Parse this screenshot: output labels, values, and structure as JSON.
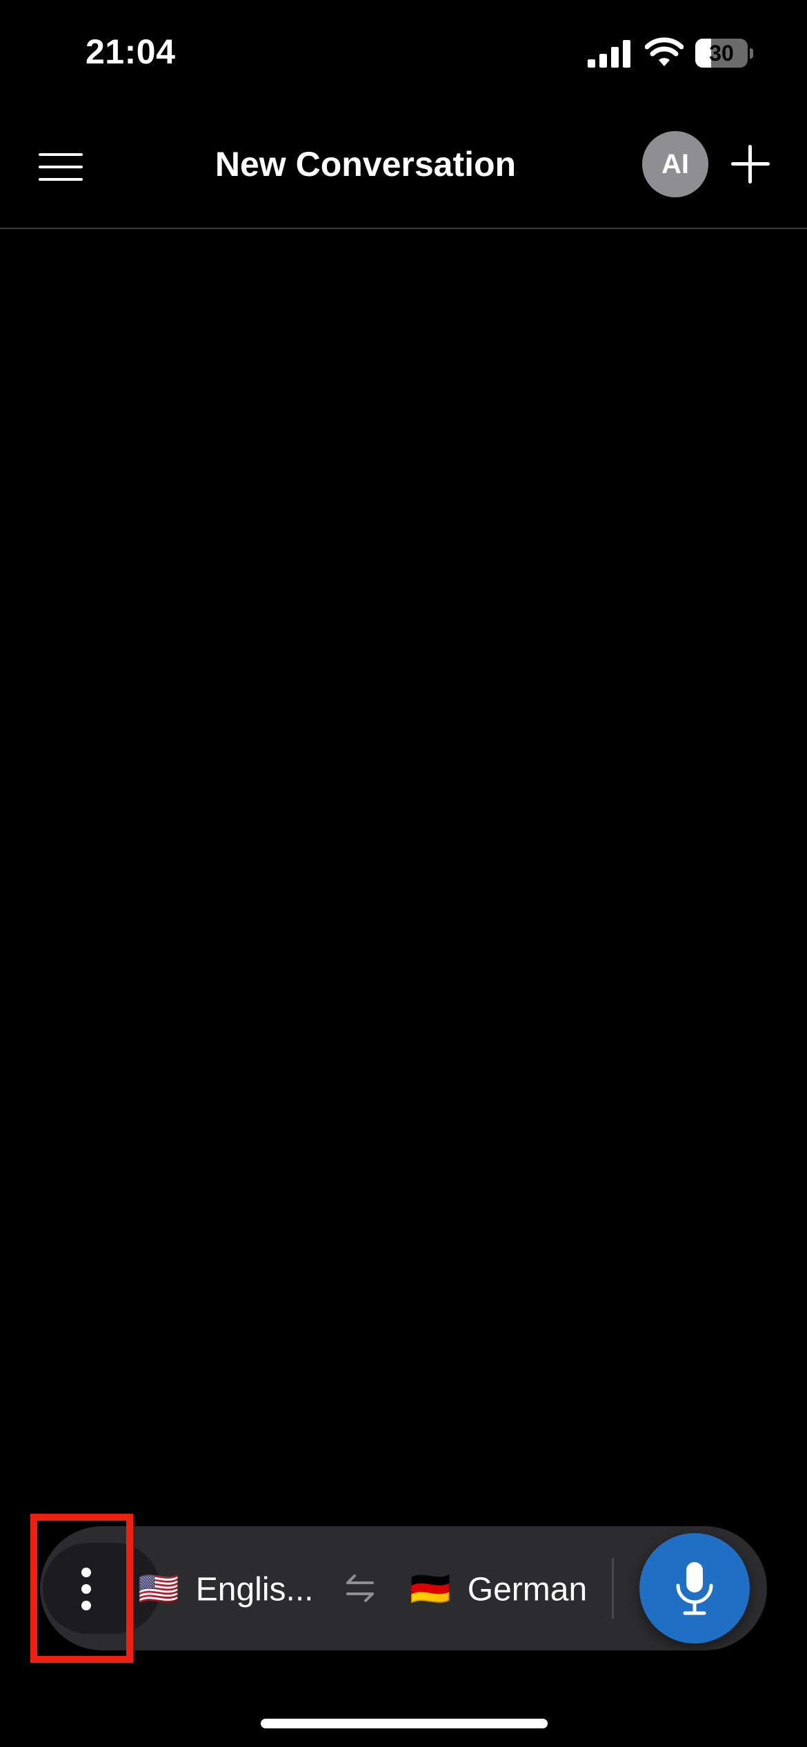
{
  "status_bar": {
    "time": "21:04",
    "battery_level": "30",
    "battery_fraction": 0.3
  },
  "header": {
    "title": "New Conversation",
    "avatar_initials": "AI",
    "menu_icon": "hamburger-menu-icon",
    "new_icon": "plus-icon"
  },
  "language_bar": {
    "more_icon": "vertical-ellipsis-icon",
    "source": {
      "flag": "🇺🇸",
      "label": "Englis..."
    },
    "swap_icon": "swap-arrows-icon",
    "target": {
      "flag": "🇩🇪",
      "label": "German"
    },
    "mic_icon": "microphone-icon"
  },
  "colors": {
    "background": "#000000",
    "accent": "#1f6fc4",
    "bar": "#2c2c2e",
    "avatar": "#8e8e93",
    "highlight": "#f0200e"
  }
}
